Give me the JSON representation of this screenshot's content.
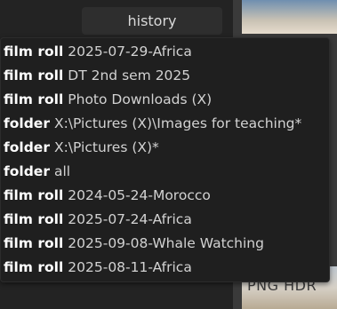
{
  "header": {
    "history_label": "history"
  },
  "thumbnails": {
    "bottom_label": "PNG HDR"
  },
  "history_popup": {
    "items": [
      {
        "type": "film roll",
        "path": "2025-07-29-Africa"
      },
      {
        "type": "film roll",
        "path": "DT 2nd sem 2025"
      },
      {
        "type": "film roll",
        "path": "Photo Downloads (X)"
      },
      {
        "type": "folder",
        "path": "X:\\Pictures (X)\\Images for teaching*"
      },
      {
        "type": "folder",
        "path": "X:\\Pictures (X)*"
      },
      {
        "type": "folder",
        "path": "all"
      },
      {
        "type": "film roll",
        "path": "2024-05-24-Morocco"
      },
      {
        "type": "film roll",
        "path": "2025-07-24-Africa"
      },
      {
        "type": "film roll",
        "path": "2025-09-08-Whale Watching"
      },
      {
        "type": "film roll",
        "path": "2025-08-11-Africa"
      }
    ]
  },
  "colors": {
    "background": "#232323",
    "popup_background": "#1f1f1f",
    "type_text": "#ffffff",
    "path_text": "#d2d2d2"
  }
}
